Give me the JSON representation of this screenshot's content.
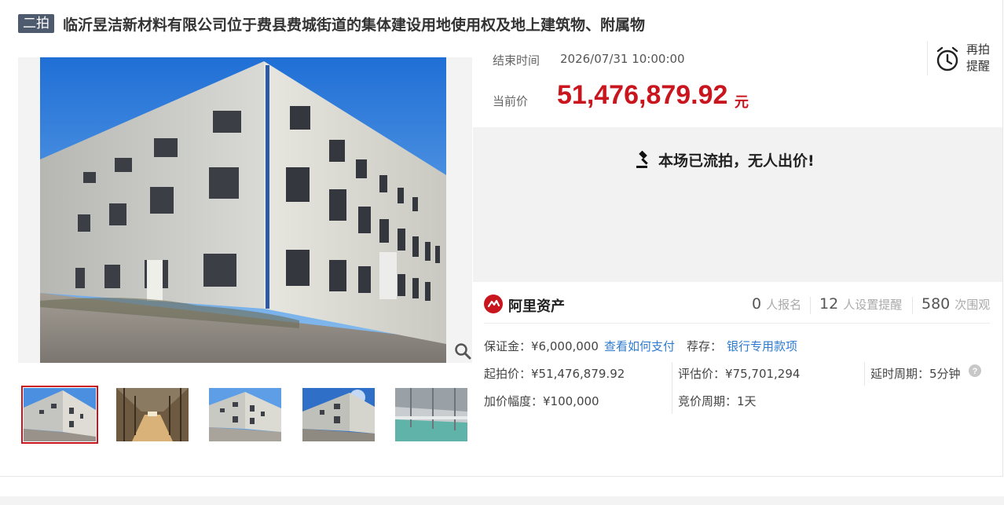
{
  "header": {
    "badge": "二拍",
    "title": "临沂昱洁新材料有限公司位于费县费城街道的集体建设用地使用权及地上建筑物、附属物"
  },
  "auction": {
    "end_time_label": "结束时间",
    "end_time_value": "2026/07/31 10:00:00",
    "current_price_label": "当前价",
    "current_price_value": "51,476,879.92",
    "current_price_unit": "元",
    "reminder_label": "再拍提醒",
    "status_message": "本场已流拍，无人出价!"
  },
  "platform": {
    "name": "阿里资产",
    "stats": [
      {
        "value": "0",
        "unit": "人报名"
      },
      {
        "value": "12",
        "unit": "人设置提醒"
      },
      {
        "value": "580",
        "unit": "次围观"
      }
    ]
  },
  "details": {
    "deposit": "保证金：¥6,000,000",
    "how_to_pay_link": "查看如何支付",
    "recommend_label": "荐存：",
    "recommend_link": "银行专用款项",
    "starting_price": "起拍价：¥51,476,879.92",
    "appraisal": "评估价：¥75,701,294",
    "delay_cycle": "延时周期：5分钟",
    "increment": "加价幅度：¥100,000",
    "bidding_cycle": "竞价周期：1天"
  },
  "gallery": {
    "thumbnail_count": 5,
    "selected_index": 0
  },
  "colors": {
    "accent_red": "#c9151e",
    "badge_bg": "#4e5a6e",
    "link_blue": "#2f7bd0",
    "status_bg": "#f2f2f2"
  }
}
